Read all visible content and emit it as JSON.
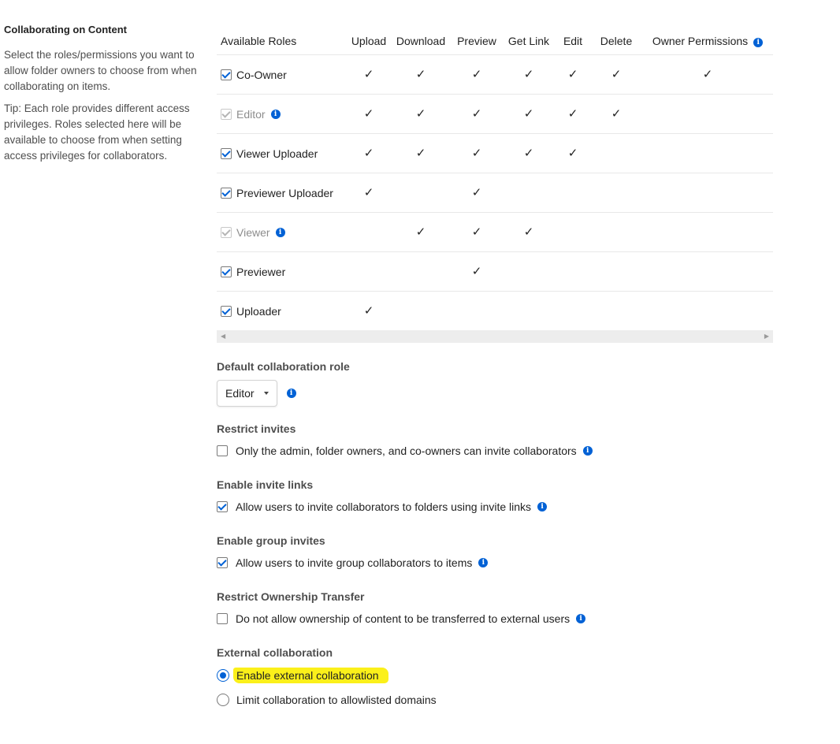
{
  "left_panel": {
    "heading": "Collaborating on Content",
    "description": "Select the roles/permissions you want to allow folder owners to choose from when collaborating on items.",
    "tip": "Tip: Each role provides different access privileges. Roles selected here will be available to choose from when setting access privileges for collaborators."
  },
  "roles_table": {
    "columns": [
      "Available Roles",
      "Upload",
      "Download",
      "Preview",
      "Get Link",
      "Edit",
      "Delete",
      "Owner Permissions"
    ],
    "rows": [
      {
        "name": "Co-Owner",
        "checked": true,
        "disabled": false,
        "info": false,
        "perms": [
          true,
          true,
          true,
          true,
          true,
          true,
          true
        ]
      },
      {
        "name": "Editor",
        "checked": true,
        "disabled": true,
        "info": true,
        "perms": [
          true,
          true,
          true,
          true,
          true,
          true,
          false
        ]
      },
      {
        "name": "Viewer Uploader",
        "checked": true,
        "disabled": false,
        "info": false,
        "perms": [
          true,
          true,
          true,
          true,
          true,
          false,
          false
        ]
      },
      {
        "name": "Previewer Uploader",
        "checked": true,
        "disabled": false,
        "info": false,
        "perms": [
          true,
          false,
          true,
          false,
          false,
          false,
          false
        ]
      },
      {
        "name": "Viewer",
        "checked": true,
        "disabled": true,
        "info": true,
        "perms": [
          false,
          true,
          true,
          true,
          false,
          false,
          false
        ]
      },
      {
        "name": "Previewer",
        "checked": true,
        "disabled": false,
        "info": false,
        "perms": [
          false,
          false,
          true,
          false,
          false,
          false,
          false
        ]
      },
      {
        "name": "Uploader",
        "checked": true,
        "disabled": false,
        "info": false,
        "perms": [
          true,
          false,
          false,
          false,
          false,
          false,
          false
        ]
      }
    ],
    "check_glyph": "✓"
  },
  "default_role": {
    "title": "Default collaboration role",
    "selected": "Editor"
  },
  "restrict_invites": {
    "title": "Restrict invites",
    "label": "Only the admin, folder owners, and co-owners can invite collaborators",
    "checked": false
  },
  "invite_links": {
    "title": "Enable invite links",
    "label": "Allow users to invite collaborators to folders using invite links",
    "checked": true
  },
  "group_invites": {
    "title": "Enable group invites",
    "label": "Allow users to invite group collaborators to items",
    "checked": true
  },
  "ownership_transfer": {
    "title": "Restrict Ownership Transfer",
    "label": "Do not allow ownership of content to be transferred to external users",
    "checked": false
  },
  "external_collab": {
    "title": "External collaboration",
    "options": [
      "Enable external collaboration",
      "Limit collaboration to allowlisted domains"
    ],
    "selected_index": 0,
    "highlight_color": "#fbf01a"
  },
  "info_glyph": "i",
  "colors": {
    "accent": "#0061d5",
    "highlight": "#fbf01a"
  }
}
